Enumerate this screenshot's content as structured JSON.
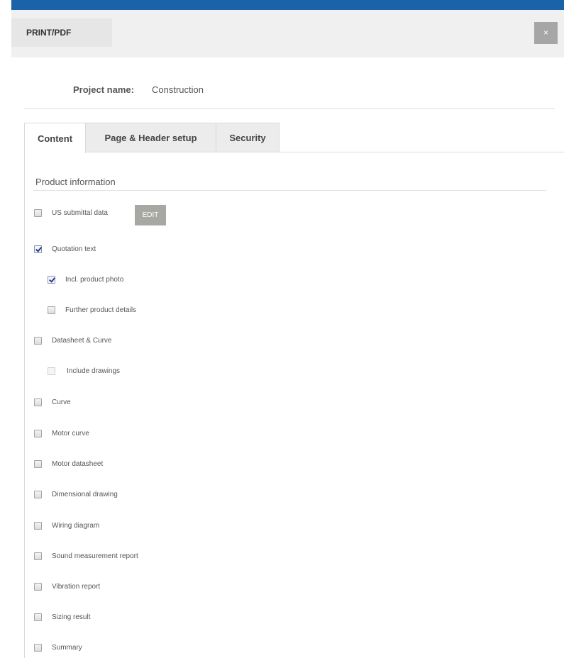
{
  "dialog": {
    "title": "PRINT/PDF",
    "close_label": "×"
  },
  "project": {
    "label": "Project name:",
    "value": "Construction"
  },
  "tabs": [
    {
      "label": "Content",
      "active": true
    },
    {
      "label": "Page & Header setup",
      "active": false
    },
    {
      "label": "Security",
      "active": false
    }
  ],
  "section": {
    "title": "Product information"
  },
  "edit_label": "EDIT",
  "options": [
    {
      "label": "US submittal data",
      "checked": false
    },
    {
      "label": "Quotation text",
      "checked": true
    },
    {
      "label": "Incl. product photo",
      "checked": true
    },
    {
      "label": "Further product details",
      "checked": false
    },
    {
      "label": "Datasheet & Curve",
      "checked": false
    },
    {
      "label": "Include drawings",
      "checked": false,
      "disabled": true
    },
    {
      "label": "Curve",
      "checked": false
    },
    {
      "label": "Motor curve",
      "checked": false
    },
    {
      "label": "Motor datasheet",
      "checked": false
    },
    {
      "label": "Dimensional drawing",
      "checked": false
    },
    {
      "label": "Wiring diagram",
      "checked": false
    },
    {
      "label": "Sound measurement report",
      "checked": false
    },
    {
      "label": "Vibration report",
      "checked": false
    },
    {
      "label": "Sizing result",
      "checked": false
    },
    {
      "label": "Summary",
      "checked": false
    }
  ],
  "colors": {
    "accent_stripe": "#1a63a8",
    "edit_button": "#a8a8a2",
    "close_button": "#a6a6a6"
  }
}
